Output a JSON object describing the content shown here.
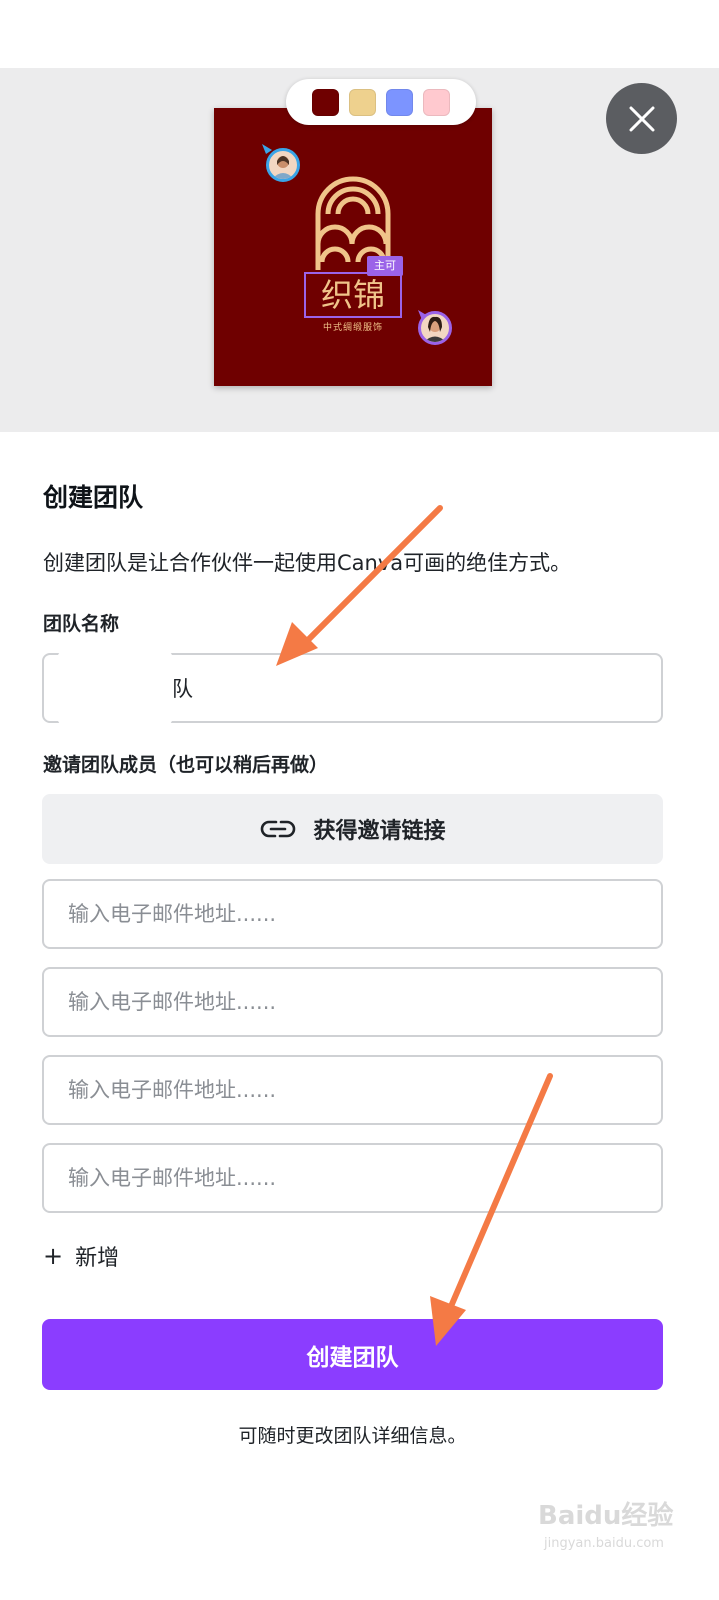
{
  "preview": {
    "palette": [
      "#6f0000",
      "#eed18e",
      "#7c94ff",
      "#ffc9cf"
    ],
    "brand_title": "织锦",
    "brand_badge": "主可",
    "brand_subtitle": "中式绸缎服饰",
    "card_color": "#6f0000",
    "accent_color": "#9b63e8"
  },
  "dialog": {
    "title": "创建团队",
    "description": "创建团队是让合作伙伴一起使用Canva可画的绝佳方式。",
    "team_name_label": "团队名称",
    "team_name_value": "队",
    "invite_label": "邀请团队成员（也可以稍后再做）",
    "invite_link_label": "获得邀请链接",
    "email_placeholder": "输入电子邮件地址......",
    "add_more_label": "新增",
    "add_more_icon": "+",
    "create_button_label": "创建团队",
    "footnote": "可随时更改团队详细信息。",
    "primary_color": "#8b3dff"
  },
  "watermark": {
    "text": "Baidu经验",
    "sub": "jingyan.baidu.com"
  }
}
